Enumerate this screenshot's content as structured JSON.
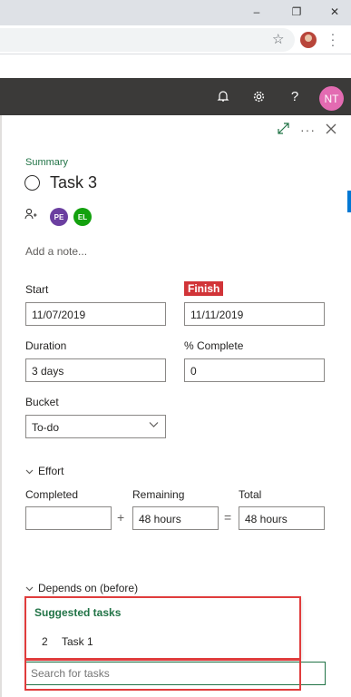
{
  "browser": {
    "window_controls": {
      "minimize": "–",
      "restore": "❐",
      "close": "✕"
    }
  },
  "appbar": {
    "avatar_initials": "NT",
    "icons": [
      "bell-icon",
      "gear-icon",
      "help-icon"
    ]
  },
  "task": {
    "section": "Summary",
    "title": "Task 3",
    "assignees": [
      {
        "initials": "PE",
        "color": "#6b3fa0"
      },
      {
        "initials": "EL",
        "color": "#13a10e"
      }
    ],
    "note_placeholder": "Add a note..."
  },
  "dates": {
    "start_label": "Start",
    "start_value": "11/07/2019",
    "finish_label": "Finish",
    "finish_value": "11/11/2019"
  },
  "progress": {
    "duration_label": "Duration",
    "duration_value": "3 days",
    "complete_label": "% Complete",
    "complete_value": "0"
  },
  "bucket": {
    "label": "Bucket",
    "value": "To-do"
  },
  "effort": {
    "heading": "Effort",
    "completed_label": "Completed",
    "completed_value": "",
    "plus": "+",
    "remaining_label": "Remaining",
    "remaining_value": "48 hours",
    "equals": "=",
    "total_label": "Total",
    "total_value": "48 hours"
  },
  "depends": {
    "heading": "Depends on (before)",
    "suggested_heading": "Suggested tasks",
    "suggestions": [
      {
        "number": "2",
        "name": "Task 1"
      }
    ],
    "search_placeholder": "Search for tasks"
  },
  "colors": {
    "accent_green": "#217346",
    "finish_red": "#d13438",
    "appbar_bg": "#3b3a39",
    "avatar_pink": "#e36bb2",
    "highlight_red": "#e03c3c"
  }
}
